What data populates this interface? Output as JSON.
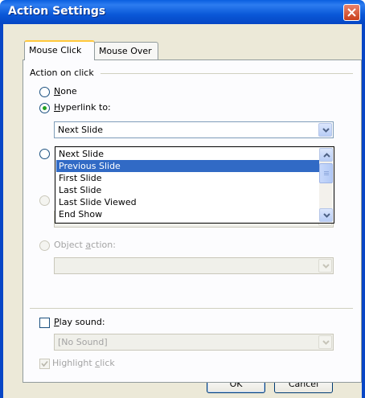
{
  "window": {
    "title": "Action Settings",
    "close_icon": "close-icon"
  },
  "tabs": [
    {
      "label": "Mouse Click",
      "active": true
    },
    {
      "label": "Mouse Over",
      "active": false
    }
  ],
  "action_group": {
    "label": "Action on click"
  },
  "options": {
    "none": {
      "pre": "",
      "key": "N",
      "post": "one",
      "selected": false,
      "enabled": true
    },
    "hyperlink": {
      "pre": "",
      "key": "H",
      "post": "yperlink to:",
      "selected": true,
      "enabled": true
    },
    "object_action": {
      "pre": "Object ",
      "key": "a",
      "post": "ction:",
      "selected": false,
      "enabled": false
    }
  },
  "hyperlink_combo": {
    "value": "Next Slide",
    "options": [
      "Next Slide",
      "Previous Slide",
      "First Slide",
      "Last Slide",
      "Last Slide Viewed",
      "End Show"
    ],
    "highlighted_index": 1
  },
  "object_action_combo": {
    "value": ""
  },
  "play_sound": {
    "pre": "",
    "key": "P",
    "post": "lay sound:",
    "checked": false,
    "enabled": true
  },
  "sound_combo": {
    "value": "[No Sound]"
  },
  "highlight_click": {
    "pre": "Highlight ",
    "key": "c",
    "post": "lick",
    "checked": true,
    "enabled": false
  },
  "buttons": {
    "ok": "OK",
    "cancel": "Cancel"
  },
  "colors": {
    "titlebar": "#0a58d8",
    "dialog_bg": "#ece9d8",
    "selection": "#316ac5",
    "tab_accent": "#ffc83c",
    "radio_dot": "#21a121"
  }
}
